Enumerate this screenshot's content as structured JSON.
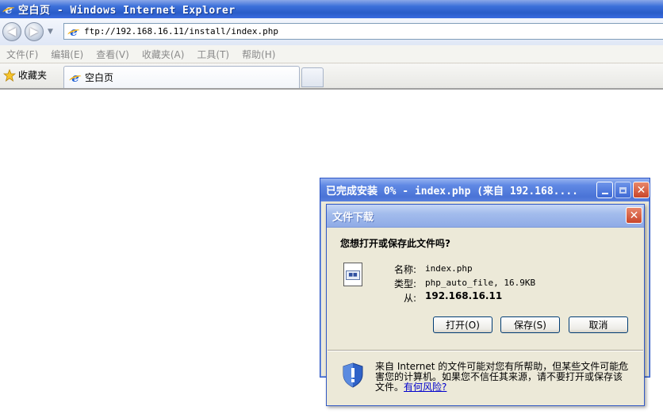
{
  "window": {
    "title": "空白页 - Windows Internet Explorer"
  },
  "address_bar": {
    "url": "ftp://192.168.16.11/install/index.php"
  },
  "menu": {
    "items": [
      "文件(F)",
      "编辑(E)",
      "查看(V)",
      "收藏夹(A)",
      "工具(T)",
      "帮助(H)"
    ]
  },
  "tabs": {
    "favorites_label": "收藏夹",
    "active_tab_label": "空白页"
  },
  "progress_window": {
    "title": "已完成安装 0% - index.php (来自 192.168...."
  },
  "download_dialog": {
    "title": "文件下载",
    "question": "您想打开或保存此文件吗?",
    "name_label": "名称:",
    "name_value": "index.php",
    "type_label": "类型:",
    "type_value": "php_auto_file, 16.9KB",
    "from_label": "从:",
    "from_value": "192.168.16.11",
    "open_button": "打开(O)",
    "save_button": "保存(S)",
    "cancel_button": "取消",
    "warning_text": "来自 Internet 的文件可能对您有所帮助，但某些文件可能危害您的计算机。如果您不信任其来源，请不要打开或保存该文件。",
    "warning_link": "有何风险?"
  },
  "colors": {
    "title_bar_blue": "#2a5cc8",
    "dialog_face": "#ece9d8",
    "link_blue": "#0000cc"
  }
}
